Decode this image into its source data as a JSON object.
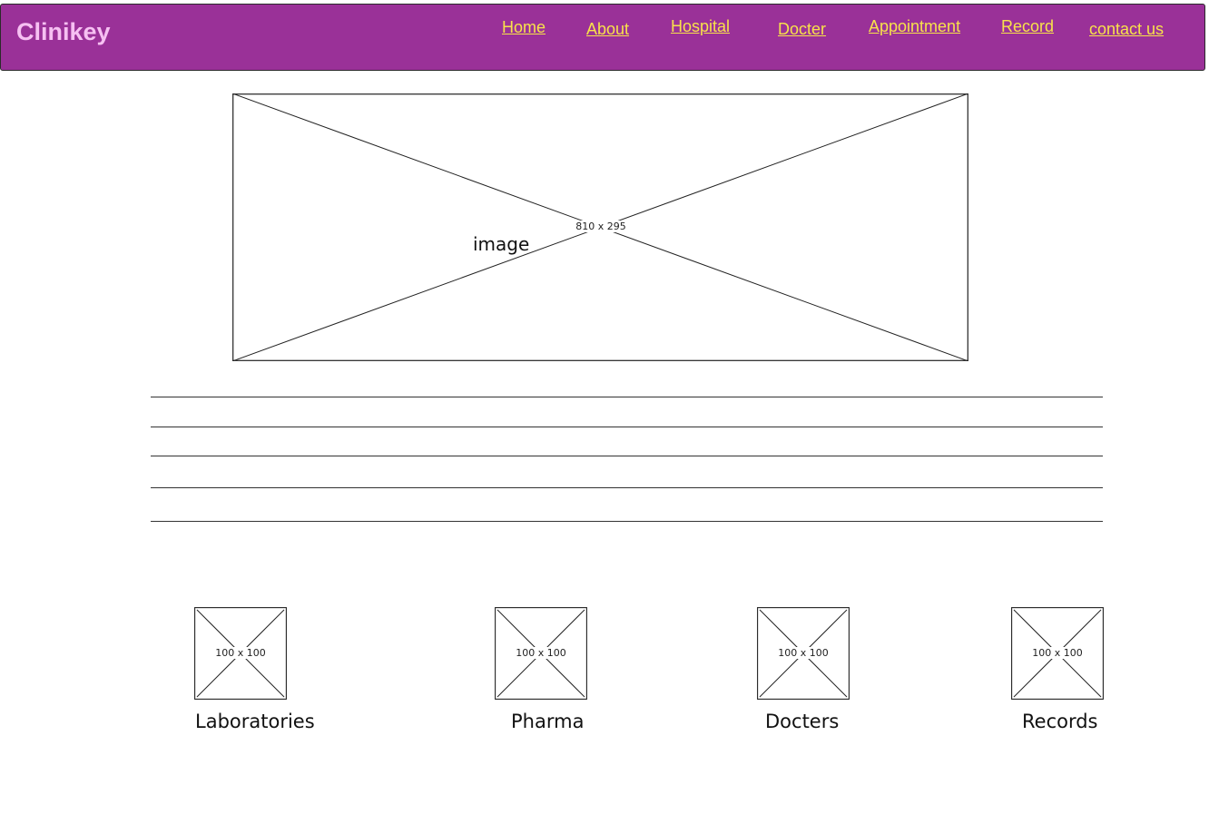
{
  "header": {
    "brand": "Clinikey",
    "nav": [
      {
        "label": "Home"
      },
      {
        "label": "About"
      },
      {
        "label": "Hospital"
      },
      {
        "label": "Docter"
      },
      {
        "label": "Appointment"
      },
      {
        "label": "Record"
      },
      {
        "label": "contact us"
      }
    ]
  },
  "hero": {
    "label": "image",
    "size_text": "810 x 295"
  },
  "cards": [
    {
      "label": "Laboratories",
      "size_text": "100 x 100"
    },
    {
      "label": "Pharma",
      "size_text": "100 x 100"
    },
    {
      "label": "Docters",
      "size_text": "100 x 100"
    },
    {
      "label": "Records",
      "size_text": "100 x 100"
    }
  ],
  "colors": {
    "header_bg": "#9a3198",
    "brand": "#f6c0f2",
    "nav_link": "#f8e24a"
  }
}
